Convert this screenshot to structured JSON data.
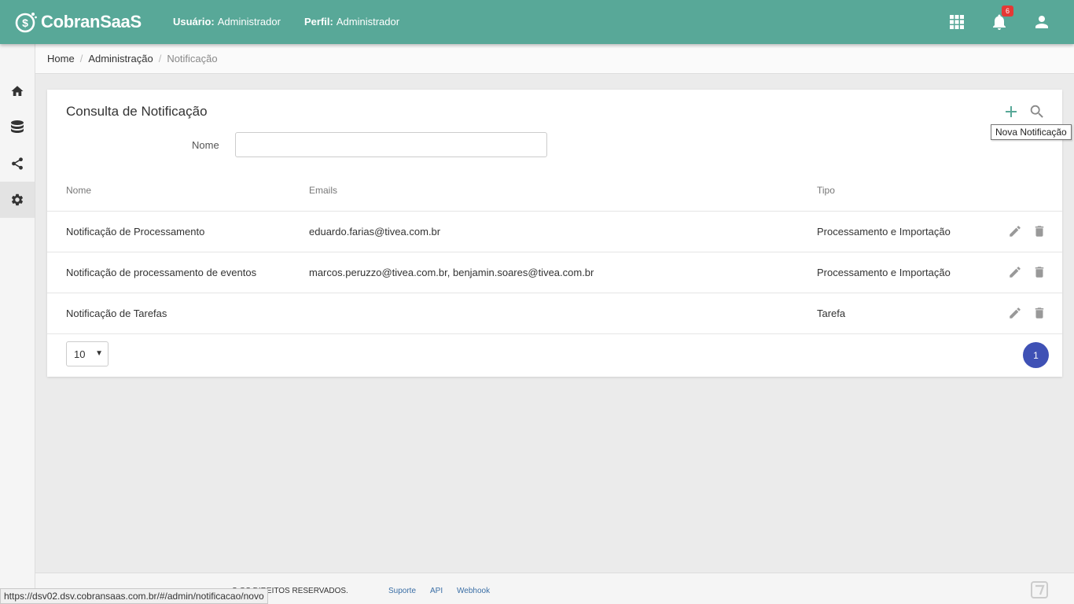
{
  "app": {
    "brand": "CobranSaaS",
    "user_label": "Usuário:",
    "user_value": "Administrador",
    "profile_label": "Perfil:",
    "profile_value": "Administrador",
    "notification_count": "6"
  },
  "breadcrumb": {
    "home": "Home",
    "admin": "Administração",
    "current": "Notificação"
  },
  "card": {
    "title": "Consulta de Notificação",
    "filter_label": "Nome",
    "filter_value": "",
    "tooltip": "Nova Notificação"
  },
  "table": {
    "headers": {
      "nome": "Nome",
      "emails": "Emails",
      "tipo": "Tipo"
    },
    "rows": [
      {
        "nome": "Notificação de Processamento",
        "emails": "eduardo.farias@tivea.com.br",
        "tipo": "Processamento e Importação"
      },
      {
        "nome": "Notificação de processamento de eventos",
        "emails": "marcos.peruzzo@tivea.com.br, benjamin.soares@tivea.com.br",
        "tipo": "Processamento e Importação"
      },
      {
        "nome": "Notificação de Tarefas",
        "emails": "",
        "tipo": "Tarefa"
      }
    ]
  },
  "pagination": {
    "page_size": "10",
    "current_page": "1"
  },
  "footer": {
    "rights": "S OS DIREITOS RESERVADOS.",
    "support": "Suporte",
    "api": "API",
    "webhook": "Webhook"
  },
  "status_url": "https://dsv02.dsv.cobransaas.com.br/#/admin/notificacao/novo",
  "colors": {
    "topbar": "#58a898",
    "primary": "#3f51b5",
    "badge": "#e53935"
  },
  "icons": [
    "logo-icon",
    "apps-grid-icon",
    "bell-icon",
    "user-icon",
    "home-icon",
    "database-icon",
    "share-icon",
    "gear-icon",
    "plus-icon",
    "search-icon",
    "pencil-icon",
    "trash-icon"
  ]
}
